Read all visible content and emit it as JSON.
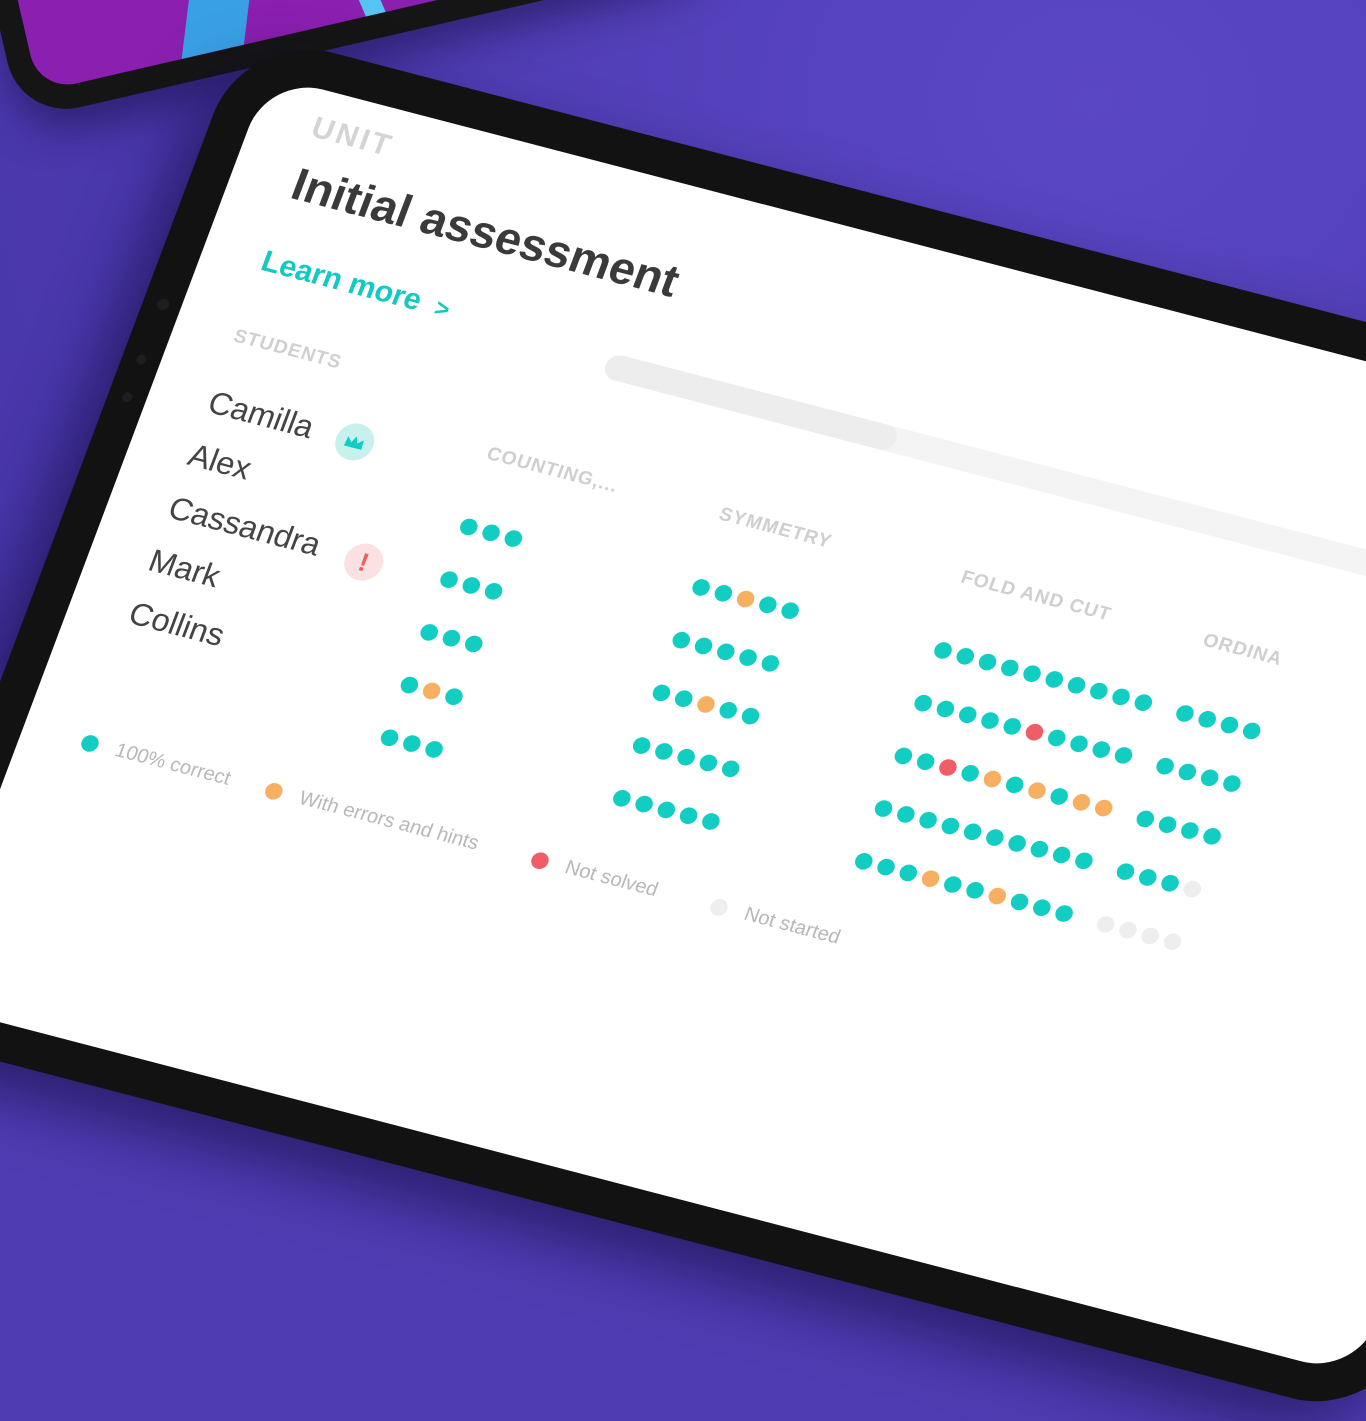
{
  "unit_label": "UNIT",
  "title": "Initial assessment",
  "learn_more": "Learn more",
  "learn_more_chevron": ">",
  "students_label": "STUDENTS",
  "students": [
    "Camilla",
    "Alex",
    "Cassandra",
    "Mark",
    "Collins"
  ],
  "badges": {
    "crown": "crown-icon",
    "alert": "!"
  },
  "columns": [
    {
      "label": "COUNTING,...",
      "rows": [
        [
          "c",
          "c",
          "c"
        ],
        [
          "c",
          "c",
          "c"
        ],
        [
          "c",
          "c",
          "c"
        ],
        [
          "c",
          "e",
          "c"
        ],
        [
          "c",
          "c",
          "c"
        ]
      ]
    },
    {
      "label": "SYMMETRY",
      "rows": [
        [
          "c",
          "c",
          "e",
          "c",
          "c"
        ],
        [
          "c",
          "c",
          "c",
          "c",
          "c"
        ],
        [
          "c",
          "c",
          "e",
          "c",
          "c"
        ],
        [
          "c",
          "c",
          "c",
          "c",
          "c"
        ],
        [
          "c",
          "c",
          "c",
          "c",
          "c"
        ]
      ]
    },
    {
      "label": "FOLD AND CUT",
      "rows": [
        [
          "c",
          "c",
          "c",
          "c",
          "c",
          "c",
          "c",
          "c",
          "c",
          "c"
        ],
        [
          "c",
          "c",
          "c",
          "c",
          "c",
          "n",
          "c",
          "c",
          "c",
          "c"
        ],
        [
          "c",
          "c",
          "n",
          "c",
          "e",
          "c",
          "e",
          "c",
          "e",
          "e"
        ],
        [
          "c",
          "c",
          "c",
          "c",
          "c",
          "c",
          "c",
          "c",
          "c",
          "c"
        ],
        [
          "c",
          "c",
          "c",
          "e",
          "c",
          "c",
          "e",
          "c",
          "c",
          "c"
        ]
      ]
    },
    {
      "label": "ORDINA",
      "rows": [
        [
          "c",
          "c",
          "c",
          "c"
        ],
        [
          "c",
          "c",
          "c",
          "c"
        ],
        [
          "c",
          "c",
          "c",
          "c"
        ],
        [
          "c",
          "c",
          "c",
          "s"
        ],
        [
          "s",
          "s",
          "s",
          "s"
        ]
      ]
    }
  ],
  "legend": [
    {
      "label": "100% correct",
      "status": "c"
    },
    {
      "label": "With errors and hints",
      "status": "e"
    },
    {
      "label": "Not solved",
      "status": "n"
    },
    {
      "label": "Not started",
      "status": "s"
    }
  ],
  "colors": {
    "correct": "#12cdc2",
    "errors": "#f7b062",
    "not_solved": "#ef5e66",
    "not_started": "#eeeeee",
    "accent": "#13c9c4",
    "background": "#4f3cb3"
  }
}
